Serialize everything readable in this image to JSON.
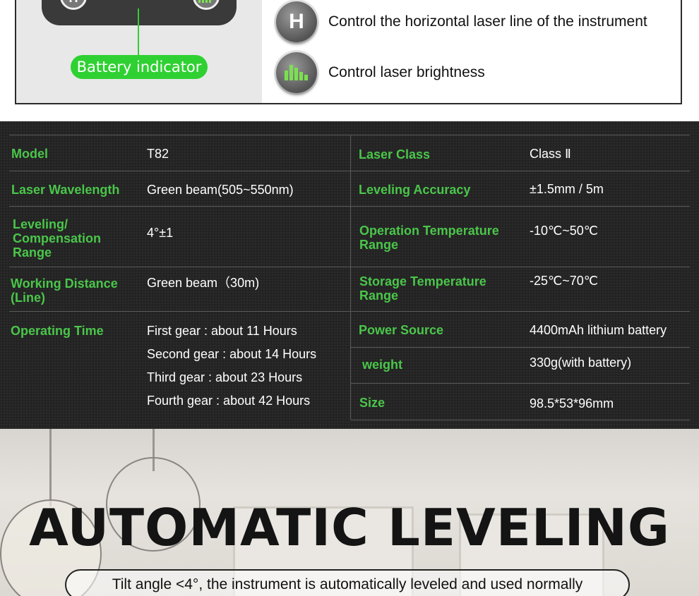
{
  "device": {
    "h_button": "H",
    "battery_label": "Battery indicator"
  },
  "legend": [
    {
      "icon": "H",
      "text": "Control the horizontal laser line of the instrument"
    },
    {
      "icon": "brightness-bars-icon",
      "text": "Control laser brightness"
    }
  ],
  "specs": {
    "left": [
      {
        "label": "Model",
        "value": "T82"
      },
      {
        "label": "Laser Wavelength",
        "value": "Green beam(505~550nm)"
      },
      {
        "label": "Leveling/ Compensation Range",
        "value": "4°±1"
      },
      {
        "label": "Working Distance (Line)",
        "value": "Green beam（30m)"
      },
      {
        "label": "Operating Time",
        "values": [
          "First gear : about 11 Hours",
          "Second gear : about 14 Hours",
          "Third gear : about 23 Hours",
          "Fourth gear : about 42 Hours"
        ]
      }
    ],
    "right": [
      {
        "label": "Laser Class",
        "value": "Class Ⅱ"
      },
      {
        "label": "Leveling Accuracy",
        "value": "±1.5mm / 5m"
      },
      {
        "label": "Operation Temperature Range",
        "value": "-10℃~50℃"
      },
      {
        "label": "Storage Temperature Range",
        "value": "-25℃~70℃"
      },
      {
        "label": "Power Source",
        "value": "4400mAh lithium battery"
      },
      {
        "label": "weight",
        "value": "330g(with battery)"
      },
      {
        "label": "Size",
        "value": "98.5*53*96mm"
      }
    ]
  },
  "hero": {
    "title": "AUTOMATIC LEVELING",
    "caption": "Tilt angle <4°, the instrument is automatically leveled and used normally"
  },
  "colors": {
    "accent_green": "#4ac64a",
    "badge_green": "#2fd132",
    "spec_bg": "#232323"
  }
}
